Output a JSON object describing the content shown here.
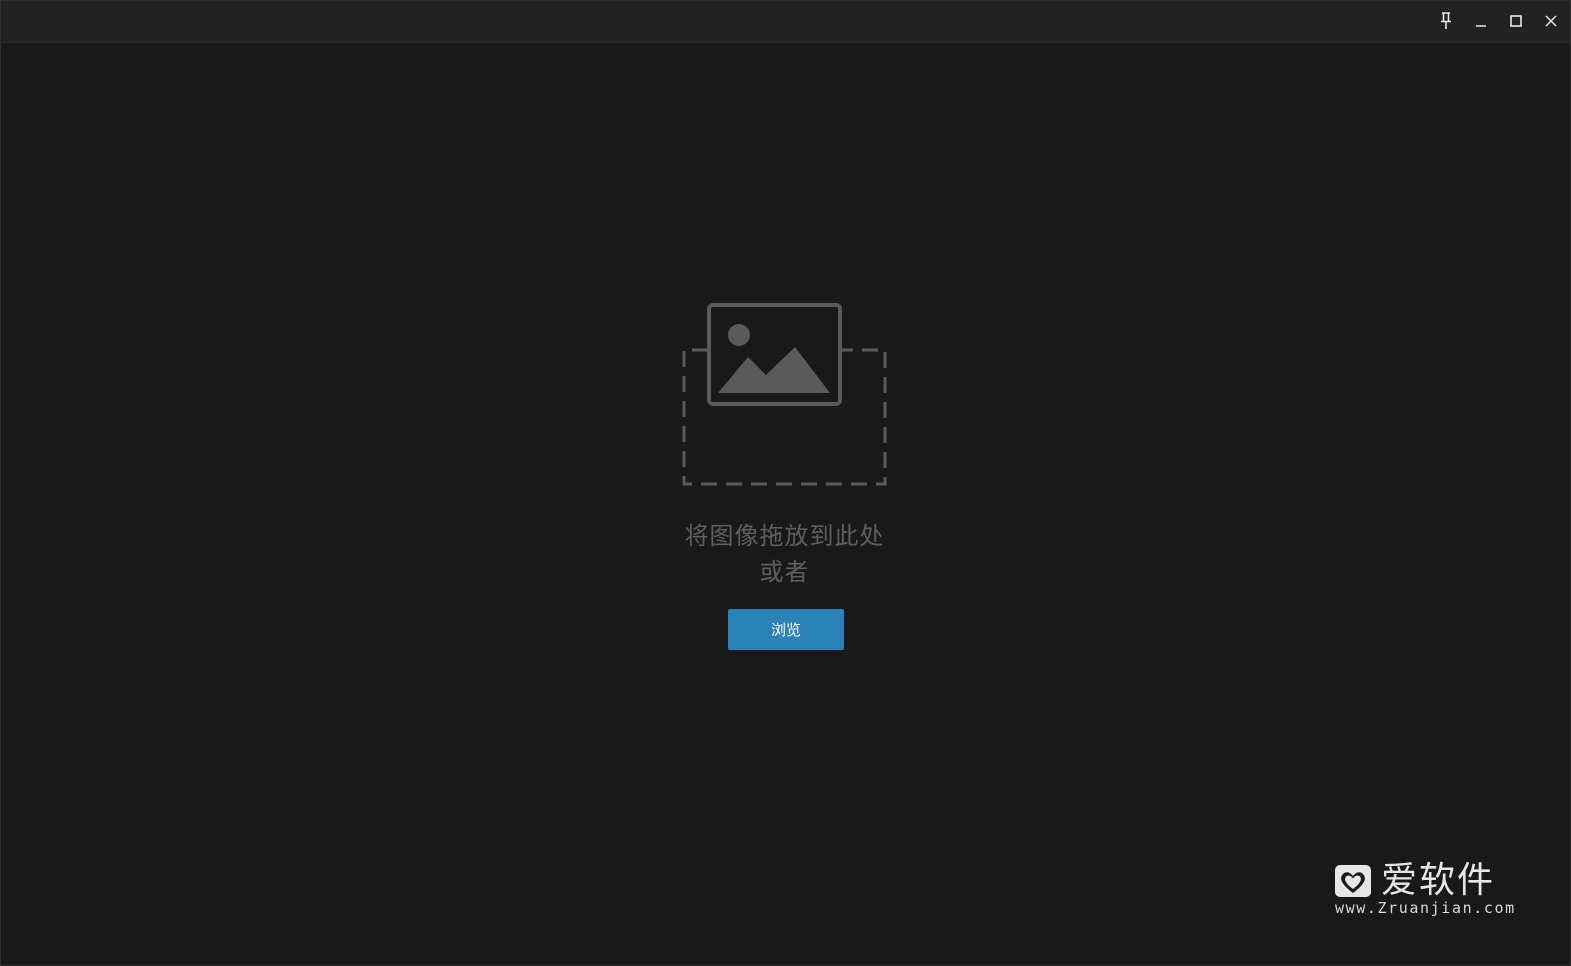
{
  "titlebar": {
    "buttons": [
      {
        "icon": "pin-icon"
      },
      {
        "icon": "minimize-icon"
      },
      {
        "icon": "maximize-icon"
      },
      {
        "icon": "close-icon"
      }
    ]
  },
  "drop": {
    "icon": "image-placeholder-icon",
    "line1": "将图像拖放到此处",
    "line2": "或者",
    "browse_label": "浏览"
  },
  "watermark": {
    "title": "爱软件",
    "url": "www.Zruanjian.com"
  },
  "colors": {
    "background": "#191919",
    "titlebar": "#222222",
    "accent": "#2b82b8",
    "placeholder_gray": "#5e5e5e"
  }
}
